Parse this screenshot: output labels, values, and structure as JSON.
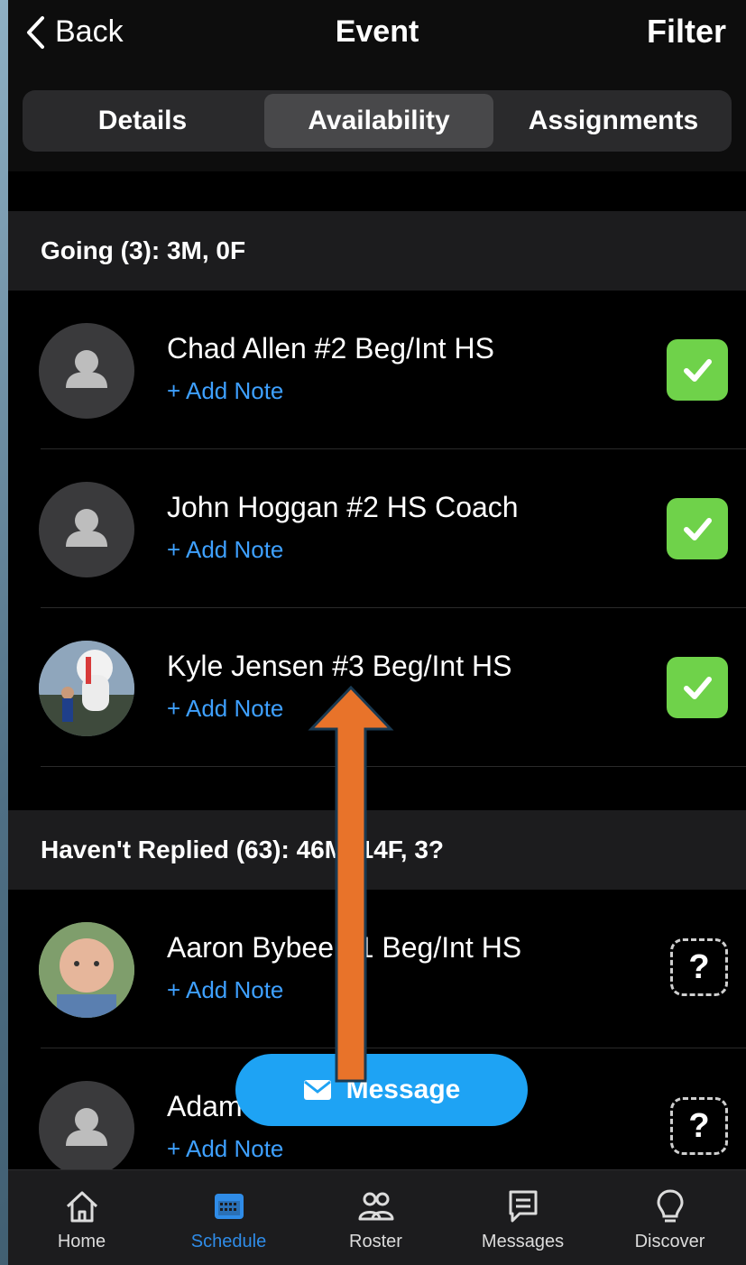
{
  "header": {
    "back_label": "Back",
    "title": "Event",
    "filter_label": "Filter"
  },
  "tabs": [
    {
      "label": "Details",
      "active": false
    },
    {
      "label": "Availability",
      "active": true
    },
    {
      "label": "Assignments",
      "active": false
    }
  ],
  "sections": {
    "going": {
      "label": "Going (3): 3M, 0F",
      "rows": [
        {
          "name": "Chad Allen #2 Beg/Int HS",
          "note": "+ Add Note",
          "status": "check"
        },
        {
          "name": "John Hoggan #2 HS Coach",
          "note": "+ Add Note",
          "status": "check"
        },
        {
          "name": "Kyle Jensen #3 Beg/Int HS",
          "note": "+ Add Note",
          "status": "check"
        }
      ]
    },
    "no_reply": {
      "label": "Haven't Replied (63): 46M, 14F, 3?",
      "rows": [
        {
          "name": "Aaron Bybee #1 Beg/Int HS",
          "note": "+ Add Note",
          "status": "?"
        },
        {
          "name": "Adam",
          "note": "+ Add Note",
          "status": "?"
        }
      ]
    }
  },
  "message_button": {
    "label": "Message",
    "icon": "envelope-icon"
  },
  "bottom_nav": [
    {
      "label": "Home",
      "icon": "home-icon",
      "active": false
    },
    {
      "label": "Schedule",
      "icon": "calendar-icon",
      "active": true
    },
    {
      "label": "Roster",
      "icon": "people-icon",
      "active": false
    },
    {
      "label": "Messages",
      "icon": "chat-icon",
      "active": false
    },
    {
      "label": "Discover",
      "icon": "lightbulb-icon",
      "active": false
    }
  ],
  "colors": {
    "accent": "#1ea3f4",
    "check_green": "#6fd24a",
    "link_blue": "#3ea0ff",
    "annotation_arrow": "#e8732a"
  }
}
